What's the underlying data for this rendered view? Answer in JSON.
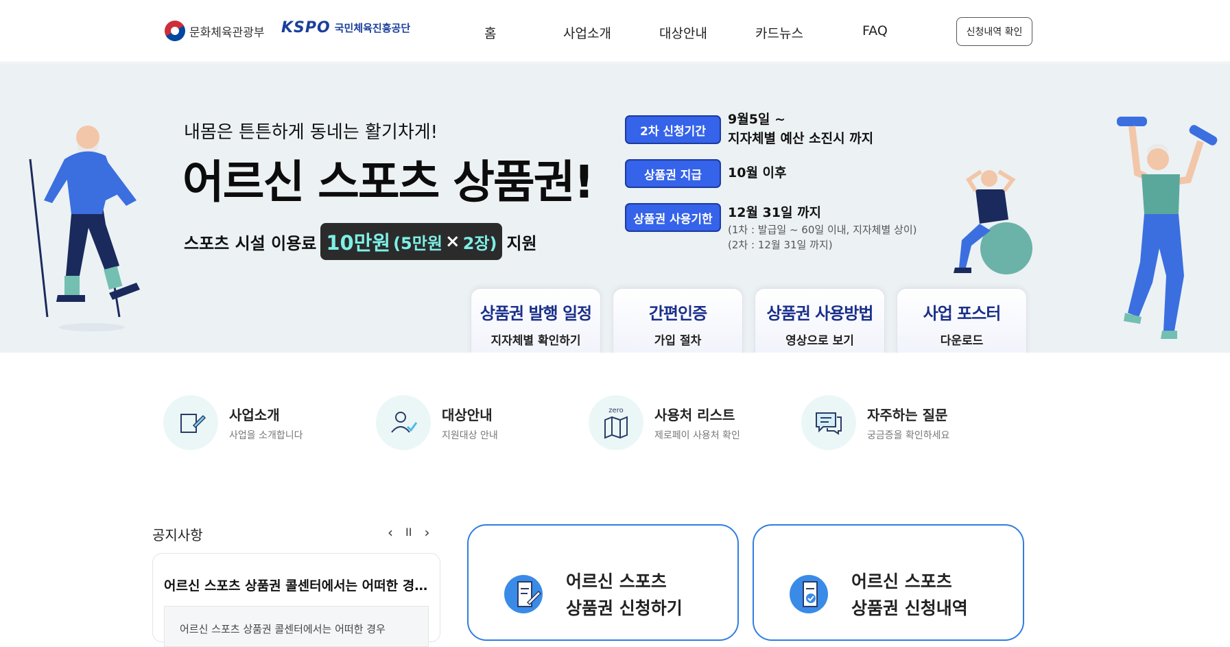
{
  "header": {
    "mcst_name": "문화체육관광부",
    "kspo_mark": "KSPO",
    "kspo_name": "국민체육진흥공단",
    "nav": [
      "홈",
      "사업소개",
      "대상안내",
      "카드뉴스",
      "FAQ"
    ],
    "check_button": "신청내역 확인"
  },
  "hero": {
    "subtitle": "내몸은 튼튼하게 동네는 활기차게!",
    "title": "어르신 스포츠 상품권!",
    "support_prefix": "스포츠 시설 이용료",
    "amount_main": "10만원",
    "amount_detail": "(5만원",
    "amount_x": "×",
    "amount_count": "2장)",
    "support_suffix": "지원",
    "schedule": [
      {
        "label": "2차 신청기간",
        "line1": "9월5일 ~",
        "line2": "지자체별 예산 소진시 까지"
      },
      {
        "label": "상품권 지급",
        "line1": "10월 이후"
      },
      {
        "label": "상품권 사용기한",
        "line1": "12월 31일 까지",
        "note1": "(1차 : 발급일 ~ 60일 이내, 지자체별 상이)",
        "note2": "(2차 : 12월 31일 까지)"
      }
    ],
    "quick_cards": [
      {
        "title": "상품권 발행 일정",
        "sub": "지자체별 확인하기"
      },
      {
        "title": "간편인증",
        "sub": "가입 절차"
      },
      {
        "title": "상품권 사용방법",
        "sub": "영상으로 보기"
      },
      {
        "title": "사업 포스터",
        "sub": "다운로드"
      }
    ]
  },
  "menu": [
    {
      "title": "사업소개",
      "desc": "사업을 소개합니다",
      "icon": "document-pen-icon"
    },
    {
      "title": "대상안내",
      "desc": "지원대상 안내",
      "icon": "user-check-icon"
    },
    {
      "title": "사용처 리스트",
      "desc": "제로페이 사용처 확인",
      "icon_label": "zero",
      "icon": "map-icon"
    },
    {
      "title": "자주하는 질문",
      "desc": "궁금증을 확인하세요",
      "icon": "chat-bubble-icon"
    }
  ],
  "notice": {
    "heading": "공지사항",
    "prev": "‹",
    "pause": "II",
    "next": "›",
    "item_title": "어르신 스포츠 상품권 콜센터에서는 어떠한 경우에",
    "item_body": "어르신 스포츠 상품권 콜센터에서는 어떠한 경우"
  },
  "cards": [
    {
      "line1": "어르신 스포츠",
      "line2": "상품권 신청하기"
    },
    {
      "line1": "어르신 스포츠",
      "line2": "상품권 신청내역"
    }
  ],
  "colors": {
    "accent_blue": "#3563e9",
    "hero_bg": "#ecf1f4",
    "mint": "#7ff0e6",
    "card_border": "#2f7de1"
  }
}
